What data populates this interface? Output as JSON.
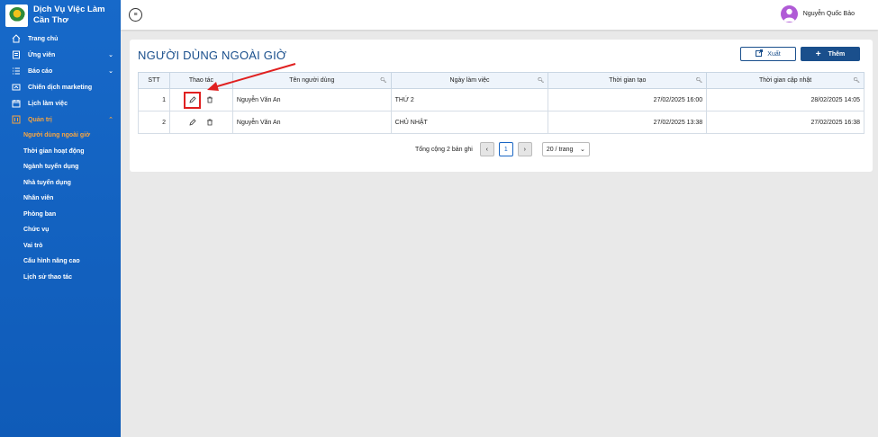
{
  "brand": {
    "title_line1": "Dịch Vụ Việc Làm",
    "title_line2": "Cần Thơ"
  },
  "sidebar": {
    "items": [
      {
        "label": "Trang chủ",
        "icon": "home-icon"
      },
      {
        "label": "Ứng viên",
        "icon": "candidate-icon",
        "expandable": true
      },
      {
        "label": "Báo cáo",
        "icon": "list-icon",
        "expandable": true
      },
      {
        "label": "Chiến dịch marketing",
        "icon": "marketing-icon"
      },
      {
        "label": "Lịch làm việc",
        "icon": "calendar-icon"
      },
      {
        "label": "Quản trị",
        "icon": "admin-icon",
        "expandable": true,
        "expanded": true
      }
    ],
    "sub_items": [
      {
        "label": "Người dùng ngoài giờ",
        "active": true
      },
      {
        "label": "Thời gian hoạt động"
      },
      {
        "label": "Ngành tuyển dụng"
      },
      {
        "label": "Nhà tuyển dụng"
      },
      {
        "label": "Nhân viên"
      },
      {
        "label": "Phòng ban"
      },
      {
        "label": "Chức vụ"
      },
      {
        "label": "Vai trò"
      },
      {
        "label": "Cấu hình nâng cao"
      },
      {
        "label": "Lịch sử thao tác"
      }
    ]
  },
  "header": {
    "user_name": "Nguyễn Quốc Bảo"
  },
  "main": {
    "title": "NGƯỜI DÙNG NGOÀI GIỜ",
    "export_label": "Xuất",
    "add_label": "Thêm",
    "columns": [
      "STT",
      "Thao tác",
      "Tên người dùng",
      "Ngày làm việc",
      "Thời gian tạo",
      "Thời gian cập nhật"
    ],
    "rows": [
      {
        "stt": "1",
        "name": "Nguyễn Văn An",
        "day": "THỨ 2",
        "created": "27/02/2025 16:00",
        "updated": "28/02/2025 14:05"
      },
      {
        "stt": "2",
        "name": "Nguyễn Văn An",
        "day": "CHỦ NHẬT",
        "created": "27/02/2025 13:38",
        "updated": "27/02/2025 16:38"
      }
    ],
    "pagination": {
      "total_text": "Tổng cộng 2 bản ghi",
      "current_page": "1",
      "page_size": "20 / trang"
    }
  },
  "colors": {
    "sidebar": "#1769c9",
    "accent": "#1a4f8c",
    "active": "#f7a541",
    "annotation": "#e02020"
  }
}
